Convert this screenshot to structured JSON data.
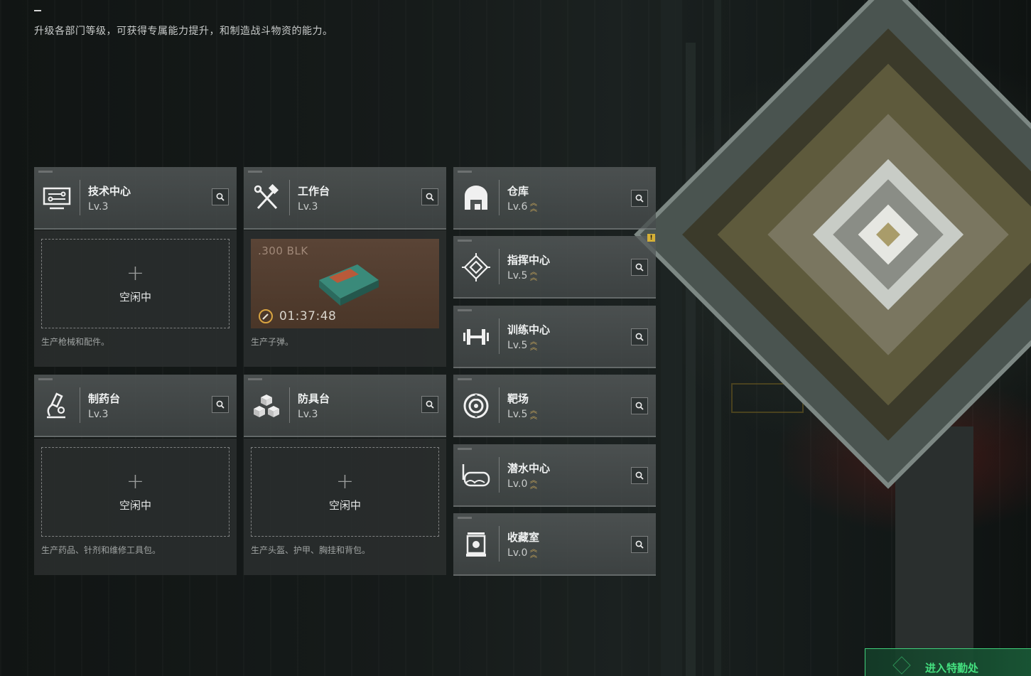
{
  "header": {
    "subtitle": "升级各部门等级，可获得专属能力提升，和制造战斗物资的能力。"
  },
  "departments": {
    "tech": {
      "name": "技术中心",
      "level": "Lv.3",
      "icon": "monitor-icon",
      "status": "空闲中",
      "desc": "生产枪械和配件。"
    },
    "workbench": {
      "name": "工作台",
      "level": "Lv.3",
      "icon": "hammer-wrench-icon",
      "item": ".300 BLK",
      "timer": "01:37:48",
      "desc": "生产子弹。"
    },
    "pharmacy": {
      "name": "制药台",
      "level": "Lv.3",
      "icon": "microscope-icon",
      "status": "空闲中",
      "desc": "生产药品、针剂和维修工具包。"
    },
    "armor": {
      "name": "防具台",
      "level": "Lv.3",
      "icon": "cubes-icon",
      "status": "空闲中",
      "desc": "生产头盔、护甲、胸挂和背包。"
    },
    "warehouse": {
      "name": "仓库",
      "level": "Lv.6",
      "icon": "warehouse-icon"
    },
    "command": {
      "name": "指挥中心",
      "level": "Lv.5",
      "icon": "diamond-target-icon",
      "alert": "!"
    },
    "training": {
      "name": "训练中心",
      "level": "Lv.5",
      "icon": "dumbbell-icon"
    },
    "range": {
      "name": "靶场",
      "level": "Lv.5",
      "icon": "target-icon"
    },
    "diving": {
      "name": "潜水中心",
      "level": "Lv.0",
      "icon": "diving-mask-icon"
    },
    "collection": {
      "name": "收藏室",
      "level": "Lv.0",
      "icon": "display-case-icon"
    }
  },
  "footer": {
    "enter_label": "进入特勤处"
  },
  "colors": {
    "accent_gold": "#c8a65a",
    "accent_green": "#44e07f",
    "card_bg": "#565b5b",
    "panel_bg": "#2c3030"
  }
}
